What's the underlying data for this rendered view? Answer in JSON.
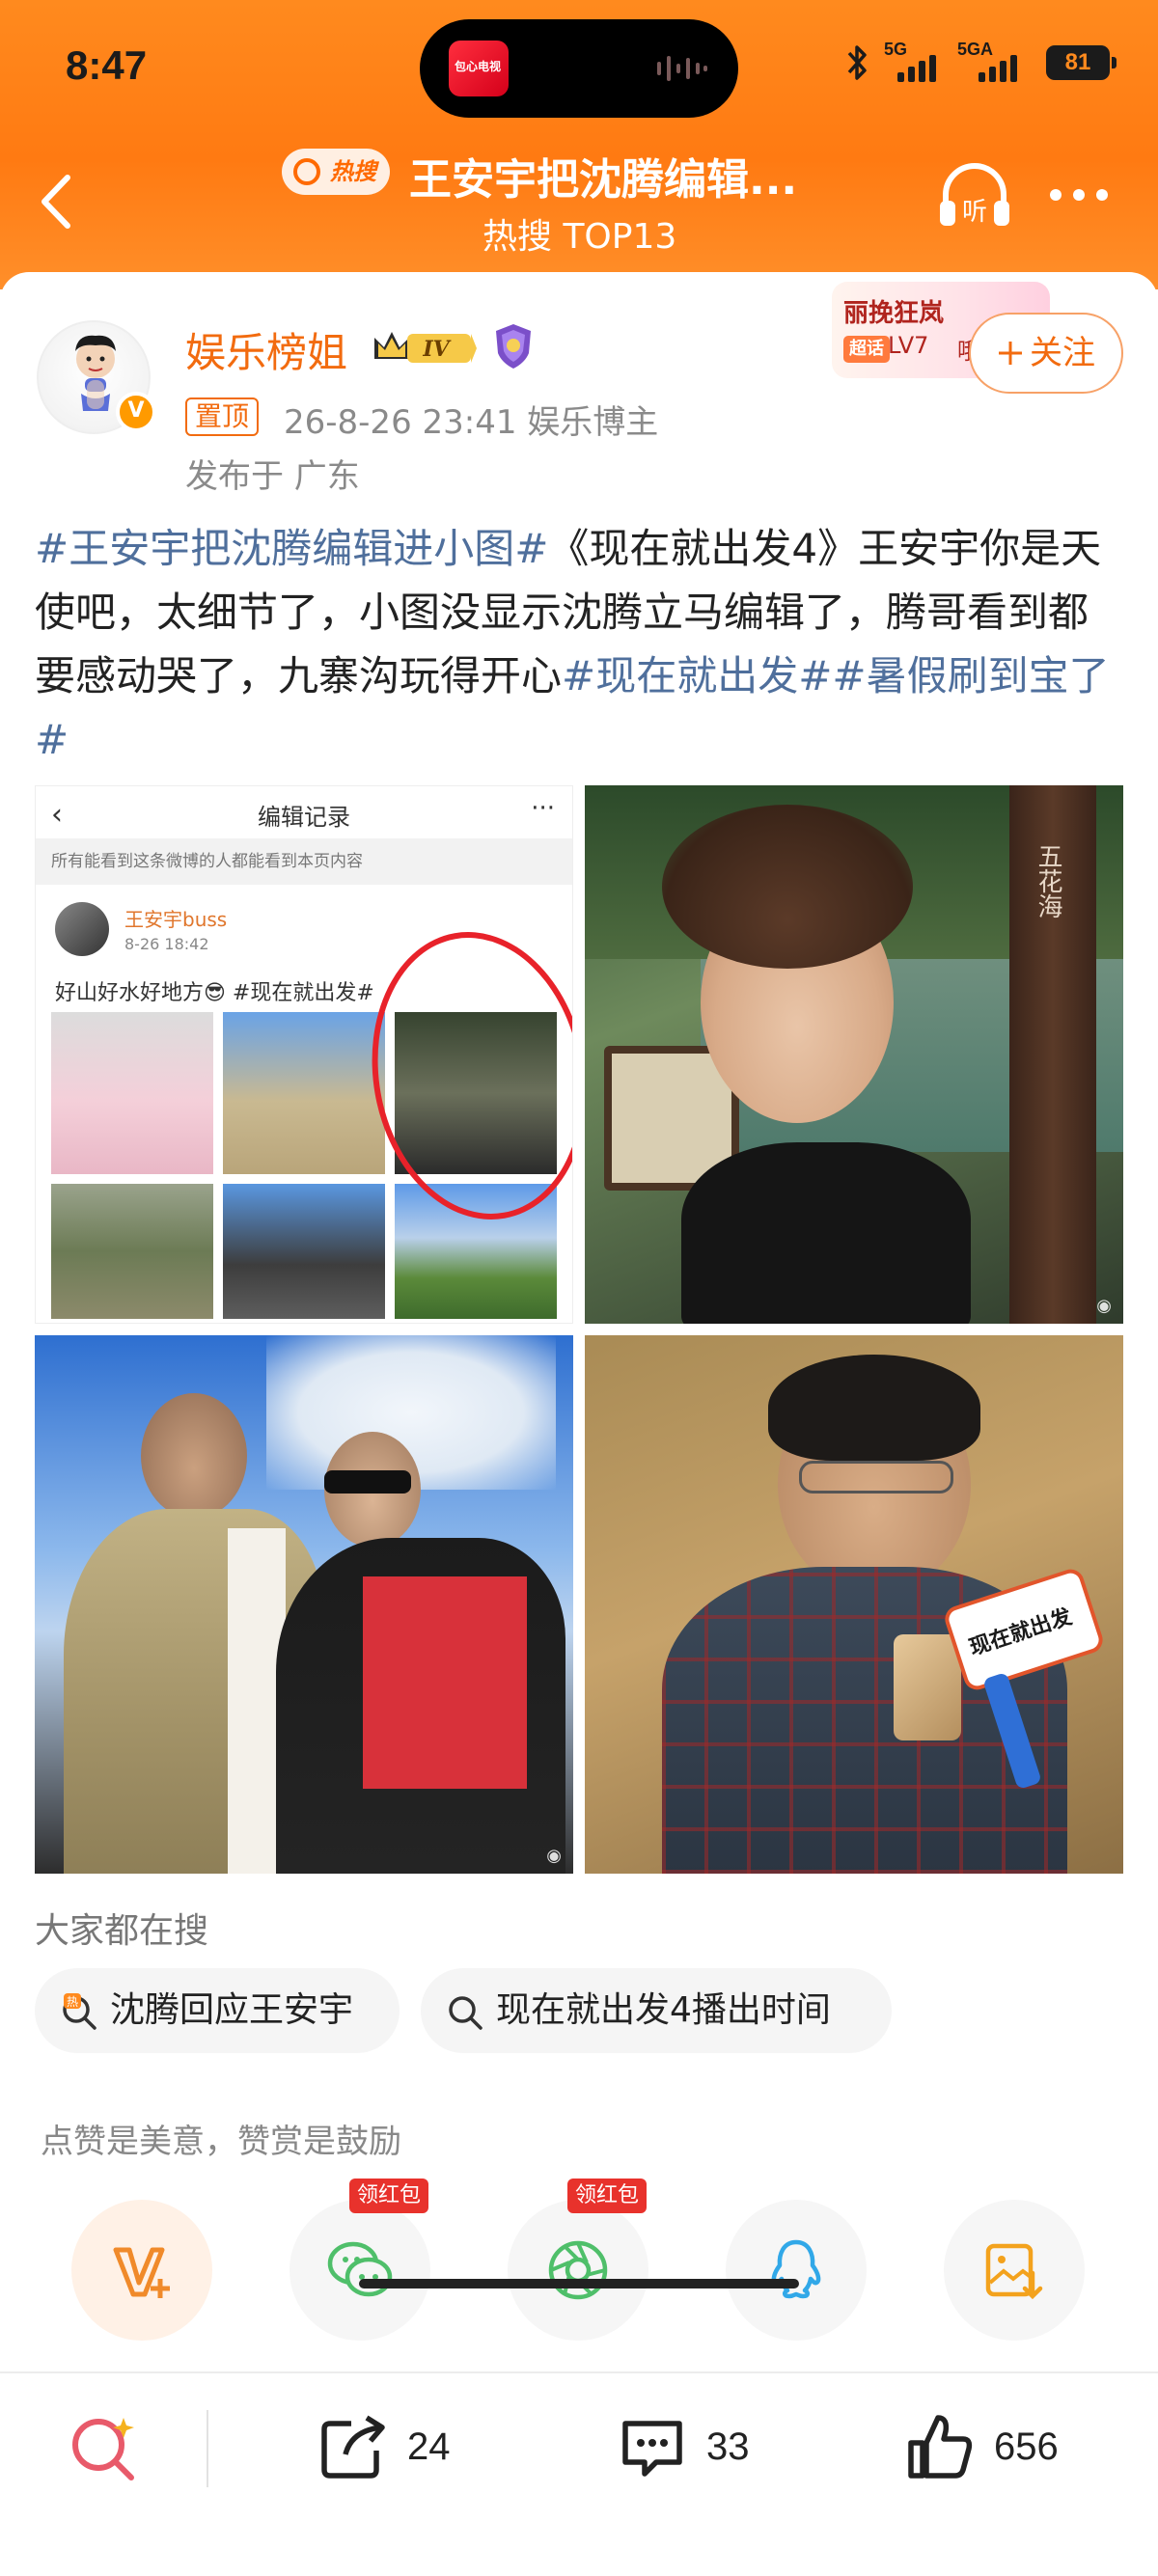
{
  "status_bar": {
    "time": "8:47",
    "island_app_text": "包心电视",
    "signal1": "5G",
    "signal2": "5GA",
    "battery": "81"
  },
  "nav": {
    "hot_pill": "热搜",
    "title": "王安宇把沈腾编辑...",
    "subtitle": "热搜 TOP13",
    "listen_label": "听"
  },
  "author": {
    "name": "娱乐榜姐",
    "vip_level": "IV",
    "pin": "置顶",
    "meta": "26-8-26 23:41   娱乐博主",
    "location": "发布于 广东"
  },
  "fan_card": {
    "name": "丽挽狂岚",
    "tag": "超话",
    "level": "LV7",
    "note": "哦莫"
  },
  "follow_label": "关注",
  "post": {
    "segments": [
      {
        "text": "#王安宇把沈腾编辑进小图#",
        "tag": true
      },
      {
        "text": "《现在就出发4》王安宇你是天使吧，太细节了，小图没显示沈腾立马编辑了，腾哥看到都要感动哭了，九寨沟玩得开心",
        "tag": false
      },
      {
        "text": "#现在就出发#",
        "tag": true
      },
      {
        "text": "#暑假刷到宝了#",
        "tag": true
      }
    ]
  },
  "images": {
    "tile1": {
      "title": "编辑记录",
      "notice": "所有能看到这条微博的人都能看到本页内容",
      "user": "王安宇buss",
      "date": "8-26 18:42",
      "text": "好山好水好地方😎 #现在就出发#"
    },
    "tile2": {
      "sign": "五花海"
    },
    "tile4": {
      "mic_text": "现在就出发"
    }
  },
  "search": {
    "title": "大家都在搜",
    "chips": [
      "沈腾回应王安宇",
      "现在就出发4播出时间"
    ]
  },
  "reward_text": "点赞是美意，赞赏是鼓励",
  "actions": {
    "red_packet_label": "领红包"
  },
  "bottom": {
    "repost_count": "24",
    "comment_count": "33",
    "like_count": "656"
  },
  "colors": {
    "brand_orange": "#ff7a12",
    "tag_blue": "#4f6f9c",
    "author_orange": "#f26b0f"
  }
}
